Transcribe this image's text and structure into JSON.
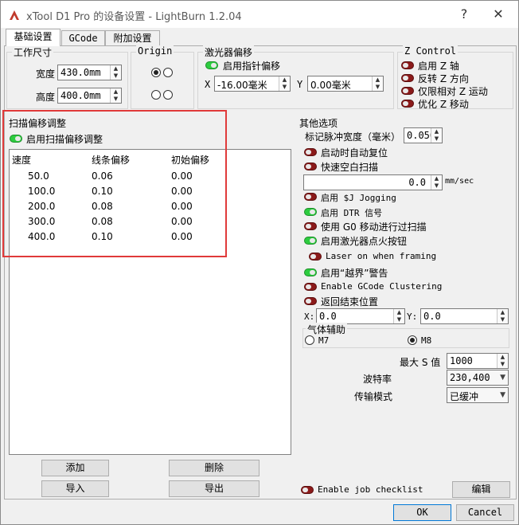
{
  "window": {
    "title": "xTool D1 Pro 的设备设置 - LightBurn 1.2.04",
    "help_label": "?",
    "close_label": "✕"
  },
  "tabs": [
    {
      "label": "基础设置",
      "active": true
    },
    {
      "label": "GCode",
      "active": false
    },
    {
      "label": "附加设置",
      "active": false
    }
  ],
  "work_size": {
    "title": "工作尺寸",
    "width_label": "宽度",
    "width_value": "430.0mm",
    "height_label": "高度",
    "height_value": "400.0mm"
  },
  "origin": {
    "title": "Origin",
    "selected": "top-left"
  },
  "laser_offset": {
    "title": "激光器偏移",
    "enable_label": "启用指针偏移",
    "enabled": true,
    "x_label": "X",
    "x_value": "-16.00毫米",
    "y_label": "Y",
    "y_value": "0.00毫米"
  },
  "z_control": {
    "title": "Z Control",
    "items": [
      {
        "label": "启用 Z 轴",
        "on": false
      },
      {
        "label": "反转 Z 方向",
        "on": false
      },
      {
        "label": "仅限相对 Z 运动",
        "on": false
      },
      {
        "label": "优化 Z 移动",
        "on": false
      }
    ]
  },
  "scan_offset": {
    "title": "扫描偏移调整",
    "enable_label": "启用扫描偏移调整",
    "enabled": true,
    "columns": [
      "速度",
      "线条偏移",
      "初始偏移"
    ],
    "rows": [
      [
        "50.0",
        "0.06",
        "0.00"
      ],
      [
        "100.0",
        "0.10",
        "0.00"
      ],
      [
        "200.0",
        "0.08",
        "0.00"
      ],
      [
        "300.0",
        "0.08",
        "0.00"
      ],
      [
        "400.0",
        "0.10",
        "0.00"
      ]
    ],
    "add_label": "添加",
    "delete_label": "删除",
    "import_label": "导入",
    "export_label": "导出"
  },
  "other": {
    "title": "其他选项",
    "pulse_label": "标记脉冲宽度（毫米）",
    "pulse_value": "0.050",
    "auto_home_label": "启动时自动复位",
    "fast_whitespace_label": "快速空白扫描",
    "speed_value": "0.0",
    "speed_unit": "mm/sec",
    "jogging_label": "启用 $J Jogging",
    "dtr_label": "启用 DTR 信号",
    "g0_label": "使用 G0 移动进行过扫描",
    "fire_label": "启用激光器点火按钮",
    "framing_label": "Laser on when framing",
    "bounds_label": "启用“越界”警告",
    "clustering_label": "Enable GCode Clustering",
    "return_label": "返回结束位置",
    "x_label": "X:",
    "x_value": "0.0",
    "y_label": "Y:",
    "y_value": "0.0",
    "air_title": "气体辅助",
    "m7_label": "M7",
    "m8_label": "M8",
    "air_selected": "M8",
    "max_s_label": "最大 S 值",
    "max_s_value": "1000",
    "baud_label": "波特率",
    "baud_value": "230,400",
    "transfer_label": "传输模式",
    "transfer_value": "已缓冲"
  },
  "footer": {
    "checklist_label": "Enable job checklist",
    "edit_label": "编辑",
    "ok_label": "OK",
    "cancel_label": "Cancel"
  },
  "colors": {
    "toggle_on": "#2ecc40",
    "toggle_off": "#8b1a1a",
    "highlight_box": "#e03a3a",
    "accent": "#0078d7"
  }
}
